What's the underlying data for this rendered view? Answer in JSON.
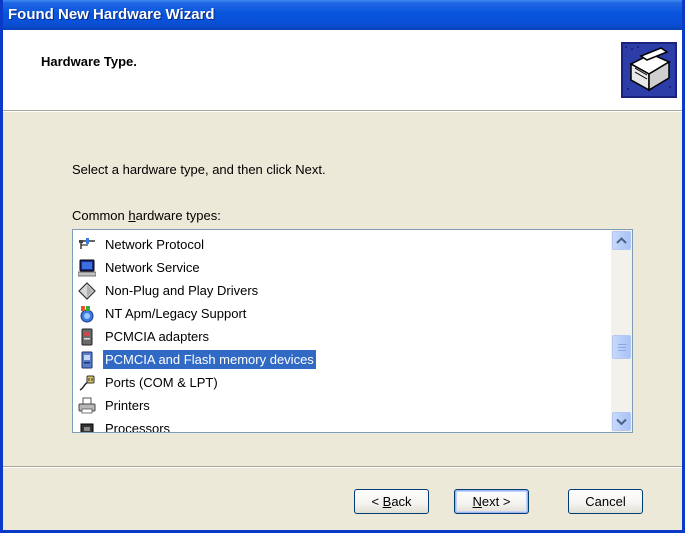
{
  "window": {
    "title": "Found New Hardware Wizard"
  },
  "header": {
    "title": "Hardware Type.",
    "icon": "hardware-install-icon"
  },
  "body": {
    "instruction": "Select a hardware type, and then click Next.",
    "list_label_prefix": "Common ",
    "list_label_accel": "h",
    "list_label_suffix": "ardware types:"
  },
  "list": {
    "items": [
      {
        "label": "Network Protocol",
        "icon": "network-protocol-icon"
      },
      {
        "label": "Network Service",
        "icon": "network-service-icon"
      },
      {
        "label": "Non-Plug and Play Drivers",
        "icon": "non-pnp-driver-icon"
      },
      {
        "label": "NT Apm/Legacy Support",
        "icon": "apm-legacy-icon"
      },
      {
        "label": "PCMCIA adapters",
        "icon": "pcmcia-card-icon"
      },
      {
        "label": "PCMCIA and Flash memory devices",
        "icon": "flash-memory-icon",
        "selected": true
      },
      {
        "label": "Ports (COM & LPT)",
        "icon": "port-connector-icon"
      },
      {
        "label": "Printers",
        "icon": "printer-icon"
      },
      {
        "label": "Processors",
        "icon": "processor-icon"
      }
    ],
    "scroll_position_fraction": 0.62
  },
  "buttons": {
    "back_prefix": "< ",
    "back_accel": "B",
    "back_suffix": "ack",
    "next_accel": "N",
    "next_suffix": "ext >",
    "cancel": "Cancel"
  },
  "colors": {
    "title_bar": "#0a4fd6",
    "selection": "#316ac5",
    "dialog_bg": "#ece9d8"
  }
}
